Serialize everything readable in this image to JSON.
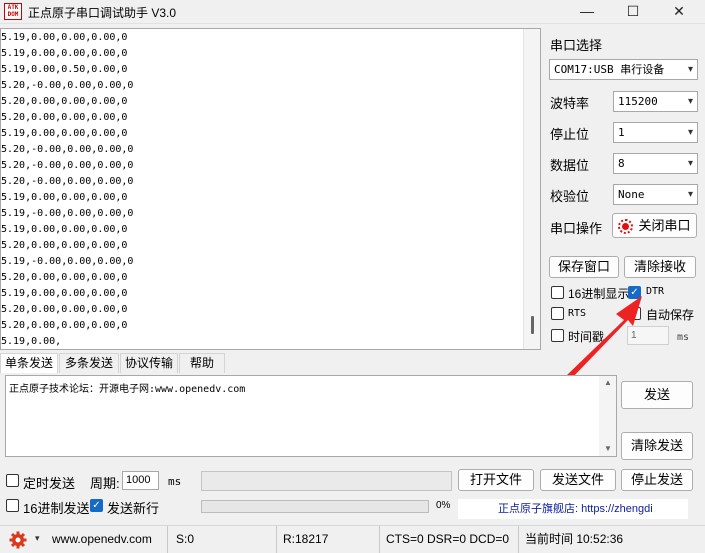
{
  "window": {
    "title": "正点原子串口调试助手 V3.0",
    "icon_text": "ATK\nDOM",
    "minimize_glyph": "—",
    "maximize_glyph": "☐",
    "close_glyph": "✕"
  },
  "receive": {
    "lines": [
      "5.19,0.00,0.00,0.00,0",
      "5.19,0.00,0.00,0.00,0",
      "5.19,0.00,0.50,0.00,0",
      "5.20,-0.00,0.00,0.00,0",
      "5.20,0.00,0.00,0.00,0",
      "5.20,0.00,0.00,0.00,0",
      "5.19,0.00,0.00,0.00,0",
      "5.20,-0.00,0.00,0.00,0",
      "5.20,-0.00,0.00,0.00,0",
      "5.20,-0.00,0.00,0.00,0",
      "5.19,0.00,0.00,0.00,0",
      "5.19,-0.00,0.00,0.00,0",
      "5.19,0.00,0.00,0.00,0",
      "5.20,0.00,0.00,0.00,0",
      "5.19,-0.00,0.00,0.00,0",
      "5.20,0.00,0.00,0.00,0",
      "5.19,0.00,0.00,0.00,0",
      "5.20,0.00,0.00,0.00,0",
      "5.20,0.00,0.00,0.00,0",
      "5.19,0.00,"
    ]
  },
  "serial": {
    "port_select_label": "串口选择",
    "port_value": "COM17:USB 串行设备",
    "baud_label": "波特率",
    "baud_value": "115200",
    "stop_label": "停止位",
    "stop_value": "1",
    "data_label": "数据位",
    "data_value": "8",
    "parity_label": "校验位",
    "parity_value": "None",
    "operate_label": "串口操作",
    "close_port_button": "关闭串口",
    "save_window_button": "保存窗口",
    "clear_receive_button": "清除接收",
    "hex_display_label": "16进制显示",
    "dtr_label": "DTR",
    "rts_label": "RTS",
    "auto_save_label": "自动保存",
    "timestamp_label": "时间戳",
    "timestamp_value": "1",
    "timestamp_unit": "ms"
  },
  "tabs": [
    "单条发送",
    "多条发送",
    "协议传输",
    "帮助"
  ],
  "send": {
    "text": "正点原子技术论坛：开源电子网:www.openedv.com",
    "send_button": "发送",
    "clear_send_button": "清除发送",
    "timed_send_label": "定时发送",
    "period_label": "周期:",
    "period_value": "1000",
    "period_unit": "ms",
    "open_file_button": "打开文件",
    "send_file_button": "发送文件",
    "stop_send_button": "停止发送",
    "hex_send_label": "16进制发送",
    "newline_label": "发送新行",
    "progress_percent": "0%",
    "progress_fraction": 0,
    "flagship_url": "正点原子旗舰店: https://zhengdi"
  },
  "status": {
    "website": "www.openedv.com",
    "sent": "S:0",
    "received": "R:18217",
    "lines": "CTS=0 DSR=0 DCD=0",
    "time": "当前时间 10:52:36"
  },
  "colors": {
    "checkbox_checked": "#1769c7",
    "close_port_indicator": "#e01010",
    "arrow_annotation": "#ee2222"
  },
  "icons": {
    "settings": "gear-icon",
    "dropdown": "chevron-down-icon",
    "port_state": "record-icon"
  }
}
